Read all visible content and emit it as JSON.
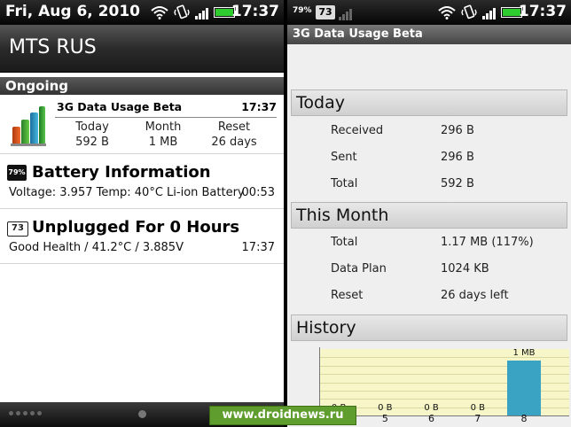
{
  "left": {
    "status": {
      "date": "Fri, Aug 6, 2010",
      "time": "17:37"
    },
    "title": "MTS RUS",
    "section": "Ongoing",
    "notifications": {
      "data": {
        "title": "3G Data Usage Beta",
        "time": "17:37",
        "columns": [
          {
            "label": "Today",
            "value": "592 B"
          },
          {
            "label": "Month",
            "value": "1 MB"
          },
          {
            "label": "Reset",
            "value": "26 days"
          }
        ]
      },
      "battery": {
        "badge": "79%",
        "title": "Battery Information",
        "subtitle": "Voltage: 3.957 Temp: 40°C Li-ion Battery",
        "time": "00:53"
      },
      "unplugged": {
        "badge": "73",
        "title": "Unplugged For 0 Hours",
        "subtitle": "Good Health / 41.2°C / 3.885V",
        "time": "17:37"
      }
    }
  },
  "watermark": "www.droidnews.ru",
  "right": {
    "status": {
      "battery_badge": "79%",
      "badge": "73",
      "time": "17:37"
    },
    "title": "3G Data Usage Beta",
    "today": {
      "header": "Today",
      "rows": [
        {
          "label": "Received",
          "value": "296 B"
        },
        {
          "label": "Sent",
          "value": "296 B"
        },
        {
          "label": "Total",
          "value": "592 B"
        }
      ]
    },
    "month": {
      "header": "This Month",
      "rows": [
        {
          "label": "Total",
          "value": "1.17 MB (117%)"
        },
        {
          "label": "Data Plan",
          "value": "1024 KB"
        },
        {
          "label": "Reset",
          "value": "26 days left"
        }
      ]
    },
    "history": {
      "header": "History"
    }
  },
  "chart_data": {
    "type": "bar",
    "categories": [
      "4",
      "5",
      "6",
      "7",
      "8"
    ],
    "values": [
      0,
      0,
      0,
      0,
      1
    ],
    "value_labels": [
      "0 B",
      "0 B",
      "0 B",
      "0 B",
      "1 MB"
    ],
    "ylim": [
      0,
      1.2
    ],
    "grid": true,
    "colors": {
      "bar": "#3aa3c4",
      "plot_bg": "#f6f6c8"
    }
  }
}
